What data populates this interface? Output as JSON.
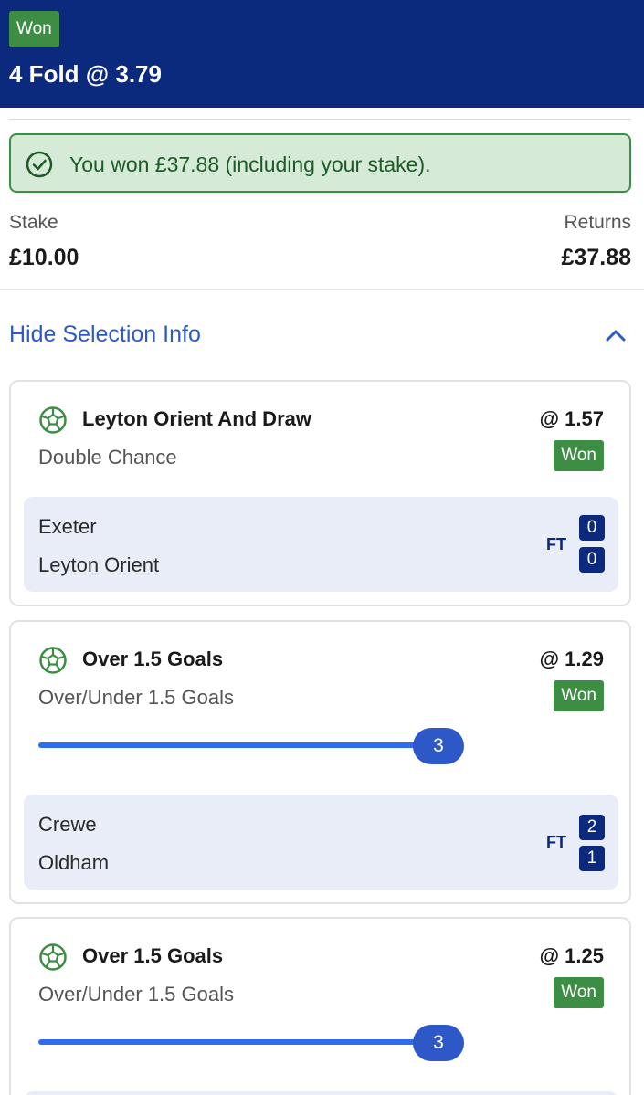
{
  "header": {
    "status": "Won",
    "title": "4 Fold @ 3.79"
  },
  "banner": {
    "message": "You won £37.88 (including your stake)."
  },
  "summary": {
    "stake_label": "Stake",
    "stake_value": "£10.00",
    "returns_label": "Returns",
    "returns_value": "£37.88"
  },
  "toggle": {
    "label": "Hide Selection Info"
  },
  "colors": {
    "header": "#0c2a7d",
    "won": "#3e8d45",
    "link": "#2c5bc4",
    "tracker": "#2e6df0"
  },
  "icons": {
    "banner": "check-circle-icon",
    "selection": "football-icon",
    "toggle": "chevron-up-icon"
  },
  "selections": [
    {
      "name": "Leyton Orient And Draw",
      "odds": "@ 1.57",
      "market": "Double Chance",
      "status": "Won",
      "home": "Exeter",
      "away": "Leyton Orient",
      "ft": "FT",
      "home_score": "0",
      "away_score": "0"
    },
    {
      "name": "Over 1.5 Goals",
      "odds": "@ 1.29",
      "market": "Over/Under 1.5 Goals",
      "status": "Won",
      "goals": "3",
      "home": "Crewe",
      "away": "Oldham",
      "ft": "FT",
      "home_score": "2",
      "away_score": "1"
    },
    {
      "name": "Over 1.5 Goals",
      "odds": "@ 1.25",
      "market": "Over/Under 1.5 Goals",
      "status": "Won",
      "goals": "3"
    }
  ]
}
